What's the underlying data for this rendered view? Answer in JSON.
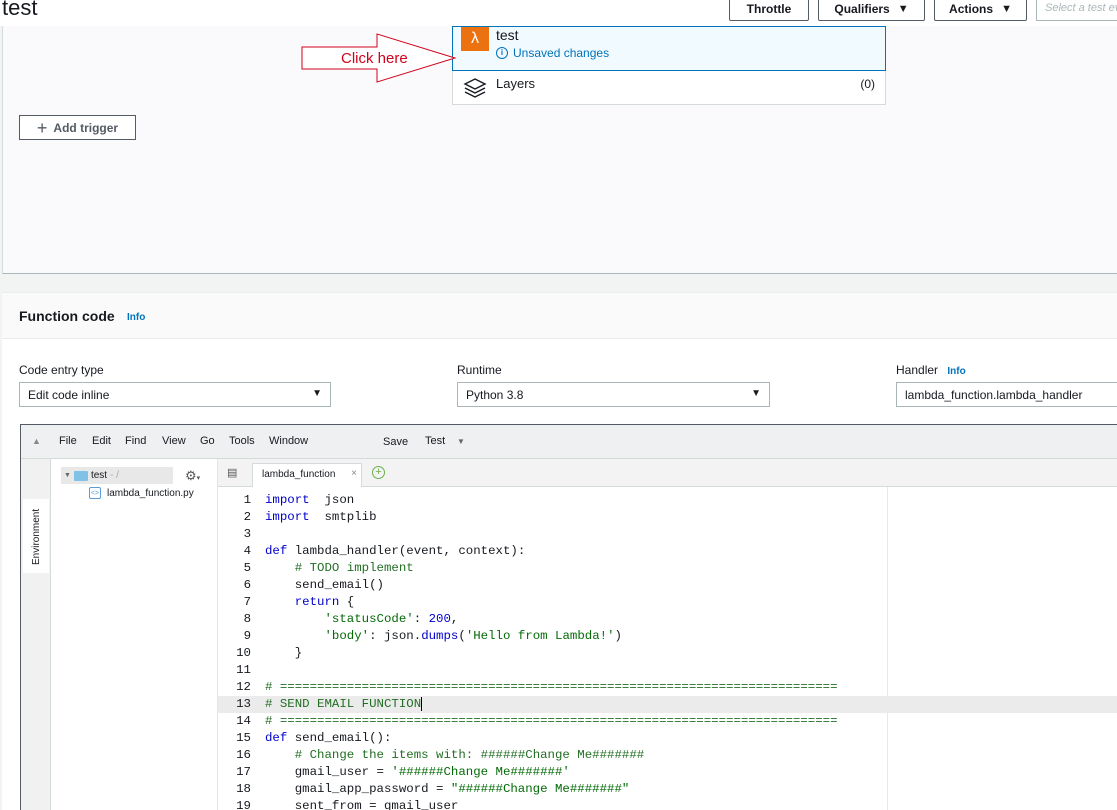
{
  "header": {
    "title": "test",
    "buttons": {
      "throttle": "Throttle",
      "qualifiers": "Qualifiers",
      "actions": "Actions"
    },
    "test_event_placeholder": "Select a test event"
  },
  "designer": {
    "function_name": "test",
    "unsaved": "Unsaved changes",
    "layers_label": "Layers",
    "layers_count": "(0)",
    "annotation": "Click here",
    "add_trigger": "Add trigger"
  },
  "function_code": {
    "title": "Function code",
    "info": "Info",
    "code_entry_label": "Code entry type",
    "code_entry_value": "Edit code inline",
    "runtime_label": "Runtime",
    "runtime_value": "Python 3.8",
    "handler_label": "Handler",
    "handler_info": "Info",
    "handler_value": "lambda_function.lambda_handler"
  },
  "editor": {
    "menu": [
      "File",
      "Edit",
      "Find",
      "View",
      "Go",
      "Tools",
      "Window",
      "Save",
      "Test"
    ],
    "side_tab": "Environment",
    "tree_root": "test",
    "tree_root_path": "- /",
    "tree_file": "lambda_function.py",
    "tab_label": "lambda_function",
    "lines": [
      {
        "n": "1",
        "segs": [
          [
            "kw",
            "import"
          ],
          [
            "",
            "  json"
          ]
        ]
      },
      {
        "n": "2",
        "segs": [
          [
            "kw",
            "import"
          ],
          [
            "",
            "  smtplib"
          ]
        ]
      },
      {
        "n": "3",
        "segs": []
      },
      {
        "n": "4",
        "segs": [
          [
            "kw",
            "def"
          ],
          [
            "",
            " lambda_handler(event, context):"
          ]
        ]
      },
      {
        "n": "5",
        "segs": [
          [
            "",
            "    "
          ],
          [
            "cm",
            "# TODO implement"
          ]
        ]
      },
      {
        "n": "6",
        "segs": [
          [
            "",
            "    send_email()"
          ]
        ]
      },
      {
        "n": "7",
        "segs": [
          [
            "",
            "    "
          ],
          [
            "kw",
            "return"
          ],
          [
            "",
            " {"
          ]
        ]
      },
      {
        "n": "8",
        "segs": [
          [
            "",
            "        "
          ],
          [
            "st",
            "'statusCode'"
          ],
          [
            "",
            ": "
          ],
          [
            "nu",
            "200"
          ],
          [
            "",
            ","
          ]
        ]
      },
      {
        "n": "9",
        "segs": [
          [
            "",
            "        "
          ],
          [
            "st",
            "'body'"
          ],
          [
            "",
            ": json."
          ],
          [
            "kw",
            "dumps"
          ],
          [
            "",
            "("
          ],
          [
            "st",
            "'Hello from Lambda!'"
          ],
          [
            "",
            ")"
          ]
        ]
      },
      {
        "n": "10",
        "segs": [
          [
            "",
            "    }"
          ]
        ]
      },
      {
        "n": "11",
        "segs": []
      },
      {
        "n": "12",
        "segs": [
          [
            "cm",
            "# ==========================================================================="
          ]
        ]
      },
      {
        "n": "13",
        "segs": [
          [
            "cm",
            "# SEND EMAIL FUNCTION"
          ]
        ],
        "active": true
      },
      {
        "n": "14",
        "segs": [
          [
            "cm",
            "# ==========================================================================="
          ]
        ]
      },
      {
        "n": "15",
        "segs": [
          [
            "kw",
            "def"
          ],
          [
            "",
            " send_email():"
          ]
        ]
      },
      {
        "n": "16",
        "segs": [
          [
            "",
            "    "
          ],
          [
            "cm",
            "# Change the items with: ######Change Me#######"
          ]
        ]
      },
      {
        "n": "17",
        "segs": [
          [
            "",
            "    gmail_user = "
          ],
          [
            "st",
            "'######Change Me#######'"
          ]
        ]
      },
      {
        "n": "18",
        "segs": [
          [
            "",
            "    gmail_app_password = "
          ],
          [
            "st",
            "\"######Change Me#######\""
          ]
        ]
      },
      {
        "n": "19",
        "segs": [
          [
            "",
            "    sent_from = gmail_user"
          ]
        ]
      }
    ]
  }
}
